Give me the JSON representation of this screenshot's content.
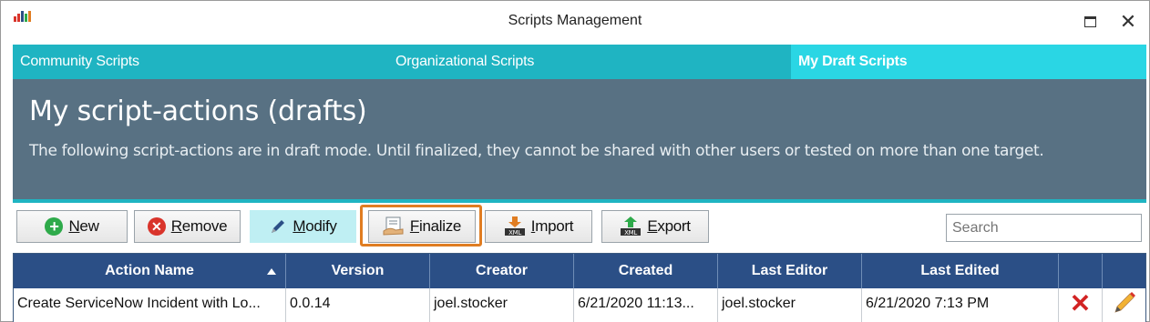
{
  "window": {
    "title": "Scripts Management",
    "icon": "app-bars-icon",
    "controls": [
      "maximize-icon",
      "close-icon"
    ],
    "close_glyph": "✕"
  },
  "tabs": [
    {
      "label": "Community Scripts",
      "active": false
    },
    {
      "label": "Organizational Scripts",
      "active": false
    },
    {
      "label": "My Draft Scripts",
      "active": true
    }
  ],
  "header": {
    "title": "My script-actions (drafts)",
    "description": "The following script-actions are in draft mode. Until finalized, they cannot be shared with other users or tested on more than one target."
  },
  "toolbar": {
    "new_label": "New",
    "remove_label": "Remove",
    "modify_label": "Modify",
    "finalize_label": "Finalize",
    "import_label": "Import",
    "export_label": "Export",
    "search_placeholder": "Search",
    "new_glyph": "+",
    "remove_glyph": "✕"
  },
  "colors": {
    "tab_bar": "#1fb4c2",
    "tab_active": "#2ad6e4",
    "header_bg": "#587183",
    "table_header": "#2b4f86",
    "highlight_border": "#e07d22"
  },
  "table": {
    "columns": [
      "Action Name",
      "Version",
      "Creator",
      "Created",
      "Last Editor",
      "Last Edited",
      "",
      ""
    ],
    "sort_column": "Action Name",
    "sort_direction": "ascending",
    "rows": [
      {
        "action_name": "Create ServiceNow Incident with Lo...",
        "version": "0.0.14",
        "creator": "joel.stocker",
        "created": "6/21/2020 11:13...",
        "last_editor": "joel.stocker",
        "last_edited": "6/21/2020 7:13 PM",
        "delete_icon": "delete-x-icon",
        "delete_glyph": "✕",
        "edit_icon": "pencil-icon"
      }
    ]
  }
}
